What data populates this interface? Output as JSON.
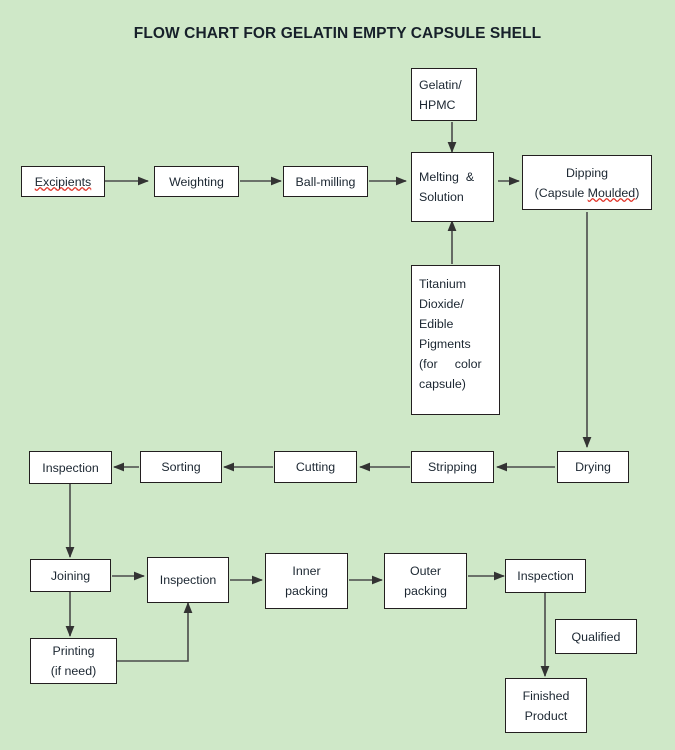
{
  "title": "FLOW CHART FOR GELATIN EMPTY CAPSULE SHELL",
  "theme": {
    "background": "#cfe8c8",
    "node_fill": "#ffffff",
    "node_border": "#231f20",
    "edge_color": "#4a4a4a",
    "text_color": "#1b2631",
    "spellcheck_underline": "#e03025"
  },
  "chart_data": {
    "type": "diagram",
    "title": "FLOW CHART FOR GELATIN EMPTY CAPSULE SHELL",
    "nodes": [
      {
        "id": "excipients",
        "label": "Excipients",
        "lines": [
          "Excipients"
        ],
        "row": 1
      },
      {
        "id": "weighting",
        "label": "Weighting",
        "lines": [
          "Weighting"
        ],
        "row": 1
      },
      {
        "id": "ball-milling",
        "label": "Ball-milling",
        "lines": [
          "Ball-milling"
        ],
        "row": 1
      },
      {
        "id": "melting-solution",
        "label": "Melting & Solution",
        "lines": [
          "Melting  &",
          "Solution"
        ],
        "row": 1
      },
      {
        "id": "dipping",
        "label": "Dipping (Capsule Moulded)",
        "lines": [
          "Dipping",
          "(Capsule Moulded)"
        ],
        "row": 1
      },
      {
        "id": "gelatin-hpmc",
        "label": "Gelatin/ HPMC",
        "lines": [
          "Gelatin/",
          "HPMC"
        ],
        "row": 0
      },
      {
        "id": "titanium-dioxide",
        "label": "Titanium Dioxide/ Edible Pigments (for color capsule)",
        "lines": [
          "Titanium",
          "Dioxide/",
          "Edible",
          "Pigments",
          "(for     color",
          "capsule)"
        ],
        "row": 2
      },
      {
        "id": "drying",
        "label": "Drying",
        "lines": [
          "Drying"
        ],
        "row": 3
      },
      {
        "id": "stripping",
        "label": "Stripping",
        "lines": [
          "Stripping"
        ],
        "row": 3
      },
      {
        "id": "cutting",
        "label": "Cutting",
        "lines": [
          "Cutting"
        ],
        "row": 3
      },
      {
        "id": "sorting",
        "label": "Sorting",
        "lines": [
          "Sorting"
        ],
        "row": 3
      },
      {
        "id": "inspection-1",
        "label": "Inspection",
        "lines": [
          "Inspection"
        ],
        "row": 3
      },
      {
        "id": "joining",
        "label": "Joining",
        "lines": [
          "Joining"
        ],
        "row": 4
      },
      {
        "id": "inspection-2",
        "label": "Inspection",
        "lines": [
          "Inspection"
        ],
        "row": 4
      },
      {
        "id": "inner-packing",
        "label": "Inner packing",
        "lines": [
          "Inner",
          "packing"
        ],
        "row": 4
      },
      {
        "id": "outer-packing",
        "label": "Outer packing",
        "lines": [
          "Outer",
          "packing"
        ],
        "row": 4
      },
      {
        "id": "inspection-3",
        "label": "Inspection",
        "lines": [
          "Inspection"
        ],
        "row": 4
      },
      {
        "id": "printing",
        "label": "Printing (if need)",
        "lines": [
          "Printing",
          "(if need)"
        ],
        "row": 5
      },
      {
        "id": "qualified",
        "label": "Qualified",
        "lines": [
          "Qualified"
        ],
        "row": 5
      },
      {
        "id": "finished-product",
        "label": "Finished Product",
        "lines": [
          "Finished",
          "Product"
        ],
        "row": 6
      }
    ],
    "edges": [
      {
        "from": "excipients",
        "to": "weighting"
      },
      {
        "from": "weighting",
        "to": "ball-milling"
      },
      {
        "from": "ball-milling",
        "to": "melting-solution"
      },
      {
        "from": "gelatin-hpmc",
        "to": "melting-solution"
      },
      {
        "from": "titanium-dioxide",
        "to": "melting-solution"
      },
      {
        "from": "melting-solution",
        "to": "dipping"
      },
      {
        "from": "dipping",
        "to": "drying"
      },
      {
        "from": "drying",
        "to": "stripping"
      },
      {
        "from": "stripping",
        "to": "cutting"
      },
      {
        "from": "cutting",
        "to": "sorting"
      },
      {
        "from": "sorting",
        "to": "inspection-1"
      },
      {
        "from": "inspection-1",
        "to": "joining"
      },
      {
        "from": "joining",
        "to": "inspection-2"
      },
      {
        "from": "joining",
        "to": "printing"
      },
      {
        "from": "printing",
        "to": "inspection-2"
      },
      {
        "from": "inspection-2",
        "to": "inner-packing"
      },
      {
        "from": "inner-packing",
        "to": "outer-packing"
      },
      {
        "from": "outer-packing",
        "to": "inspection-3"
      },
      {
        "from": "inspection-3",
        "to": "finished-product",
        "label": "Qualified"
      }
    ]
  },
  "nodes": {
    "excipients": {
      "t1": "Excipients"
    },
    "weighting": {
      "t1": "Weighting"
    },
    "ball_milling": {
      "t1": "Ball-milling"
    },
    "melting": {
      "t1": "Melting  &",
      "t2": "Solution"
    },
    "dipping": {
      "t1": "Dipping",
      "t2a": "(Capsule ",
      "t2b": "Moulded",
      "t2c": ")"
    },
    "gelatin": {
      "t1": "Gelatin/",
      "t2": "HPMC"
    },
    "titanium": {
      "t1": "Titanium",
      "t2": "Dioxide/",
      "t3": "Edible",
      "t4": "Pigments",
      "t5": "(for     color",
      "t6": "capsule)"
    },
    "drying": {
      "t1": "Drying"
    },
    "stripping": {
      "t1": "Stripping"
    },
    "cutting": {
      "t1": "Cutting"
    },
    "sorting": {
      "t1": "Sorting"
    },
    "inspection1": {
      "t1": "Inspection"
    },
    "joining": {
      "t1": "Joining"
    },
    "inspection2": {
      "t1": "Inspection"
    },
    "inner_packing": {
      "t1": "Inner",
      "t2": "packing"
    },
    "outer_packing": {
      "t1": "Outer",
      "t2": "packing"
    },
    "inspection3": {
      "t1": "Inspection"
    },
    "printing": {
      "t1": "Printing",
      "t2": "(if need)"
    },
    "qualified": {
      "t1": "Qualified"
    },
    "finished": {
      "t1": "Finished",
      "t2": "Product"
    }
  }
}
